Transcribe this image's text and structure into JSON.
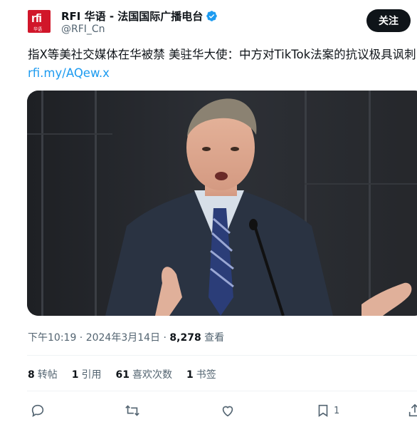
{
  "author": {
    "name": "RFI 华语 - 法国国际广播电台",
    "handle": "@RFI_Cn",
    "logo_text": "rfi",
    "logo_sub": "华语"
  },
  "follow_label": "关注",
  "tweet": {
    "text": "指X等美社交媒体在华被禁 美驻华大使：中方对TikTok法案的抗议极具讽刺",
    "link": "rfi.my/AQew.x"
  },
  "meta": {
    "time": "下午10:19 · 2024年3月14日 · ",
    "views_count": "8,278",
    "views_label": " 查看"
  },
  "stats": [
    {
      "count": "8",
      "label": "转帖"
    },
    {
      "count": "1",
      "label": "引用"
    },
    {
      "count": "61",
      "label": "喜欢次数"
    },
    {
      "count": "1",
      "label": "书签"
    }
  ],
  "actions": {
    "bookmark_count": "1"
  },
  "icons": {
    "verified": "verified-badge-icon",
    "reply": "reply-icon",
    "retweet": "retweet-icon",
    "like": "heart-icon",
    "bookmark": "bookmark-icon",
    "share": "share-icon"
  },
  "colors": {
    "accent": "#1d9bf0",
    "brand": "#d1162a",
    "text_secondary": "#536471"
  }
}
